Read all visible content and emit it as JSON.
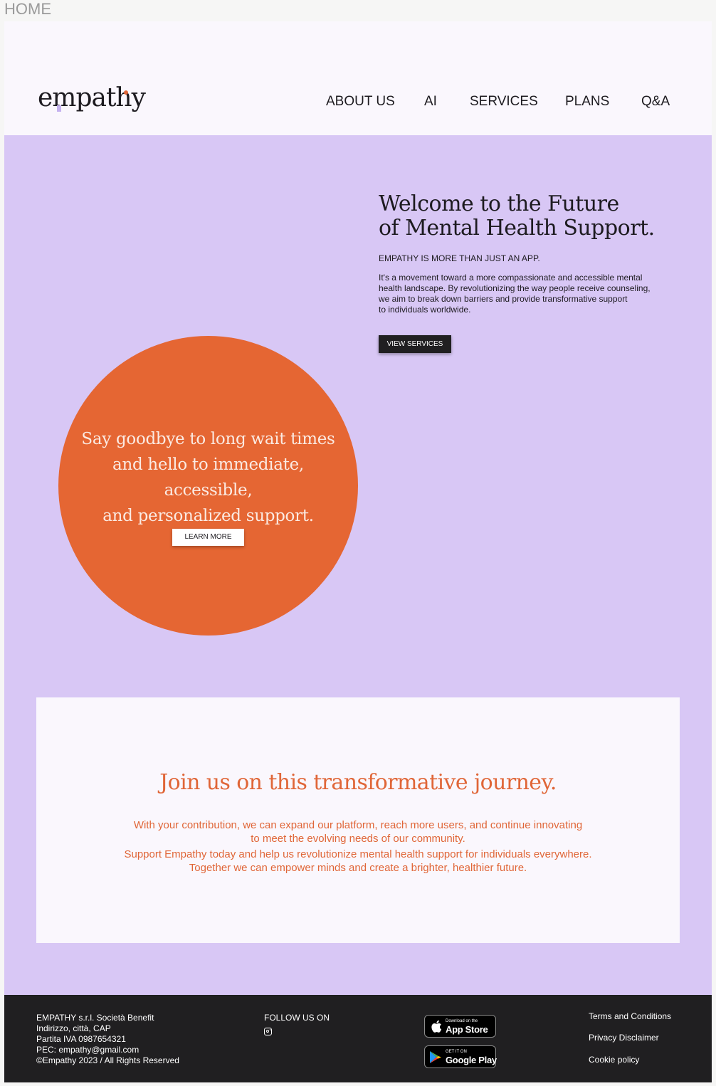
{
  "page_label": "HOME",
  "header": {
    "logo_text": "empathy",
    "nav": [
      "ABOUT US",
      "AI",
      "SERVICES",
      "PLANS",
      "Q&A"
    ]
  },
  "hero": {
    "title_line1": "Welcome to the Future",
    "title_line2": "of Mental Health Support.",
    "subtitle": "EMPATHY IS MORE THAN JUST AN APP.",
    "body_lines": [
      "It's a movement toward a more compassionate and accessible mental",
      "health landscape. By revolutionizing the way people receive counseling,",
      "we aim to break down barriers and provide transformative support",
      "to individuals worldwide."
    ],
    "cta": "VIEW SERVICES",
    "circle_lines": [
      "Say goodbye to long wait times",
      "and hello to immediate, accessible,",
      "and personalized support."
    ],
    "circle_cta": "LEARN MORE"
  },
  "join": {
    "title": "Join us on this transformative journey.",
    "lines": [
      "With your contribution, we can expand our platform, reach more users, and continue innovating",
      "to meet the evolving needs of our community.",
      "Support Empathy today and help us revolutionize mental health support for individuals everywhere.",
      "Together we can empower minds and create a brighter, healthier future."
    ]
  },
  "footer": {
    "company_lines": [
      "EMPATHY s.r.l. Società Benefit",
      "Indirizzo, città, CAP",
      "Partita IVA 0987654321",
      "PEC: empathy@gmail.com",
      "©Empathy 2023 / All Rights Reserved"
    ],
    "follow_label": "FOLLOW US ON",
    "social_icon": "instagram-icon",
    "app_store": {
      "small": "Download on the",
      "big": "App Store"
    },
    "google_play": {
      "small": "GET IT ON",
      "big": "Google Play"
    },
    "links": [
      "Terms and Conditions",
      "Privacy Disclaimer",
      "Cookie policy"
    ]
  },
  "colors": {
    "lavender": "#d8c7f5",
    "orange": "#e56633",
    "dark": "#201f21",
    "offwhite": "#faf7fd"
  }
}
